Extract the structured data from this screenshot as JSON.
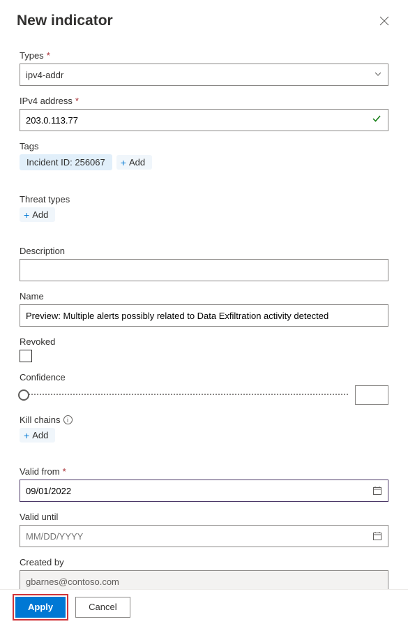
{
  "header": {
    "title": "New indicator"
  },
  "fields": {
    "types_label": "Types",
    "types_value": "ipv4-addr",
    "ipv4_label": "IPv4 address",
    "ipv4_value": "203.0.113.77",
    "tags_label": "Tags",
    "tag1": "Incident ID: 256067",
    "add_label": "Add",
    "threat_types_label": "Threat types",
    "description_label": "Description",
    "description_value": "",
    "name_label": "Name",
    "name_value": "Preview: Multiple alerts possibly related to Data Exfiltration activity detected",
    "revoked_label": "Revoked",
    "confidence_label": "Confidence",
    "kill_chains_label": "Kill chains",
    "valid_from_label": "Valid from",
    "valid_from_value": "09/01/2022",
    "valid_until_label": "Valid until",
    "valid_until_placeholder": "MM/DD/YYYY",
    "created_by_label": "Created by",
    "created_by_value": "gbarnes@contoso.com"
  },
  "footer": {
    "apply": "Apply",
    "cancel": "Cancel"
  }
}
